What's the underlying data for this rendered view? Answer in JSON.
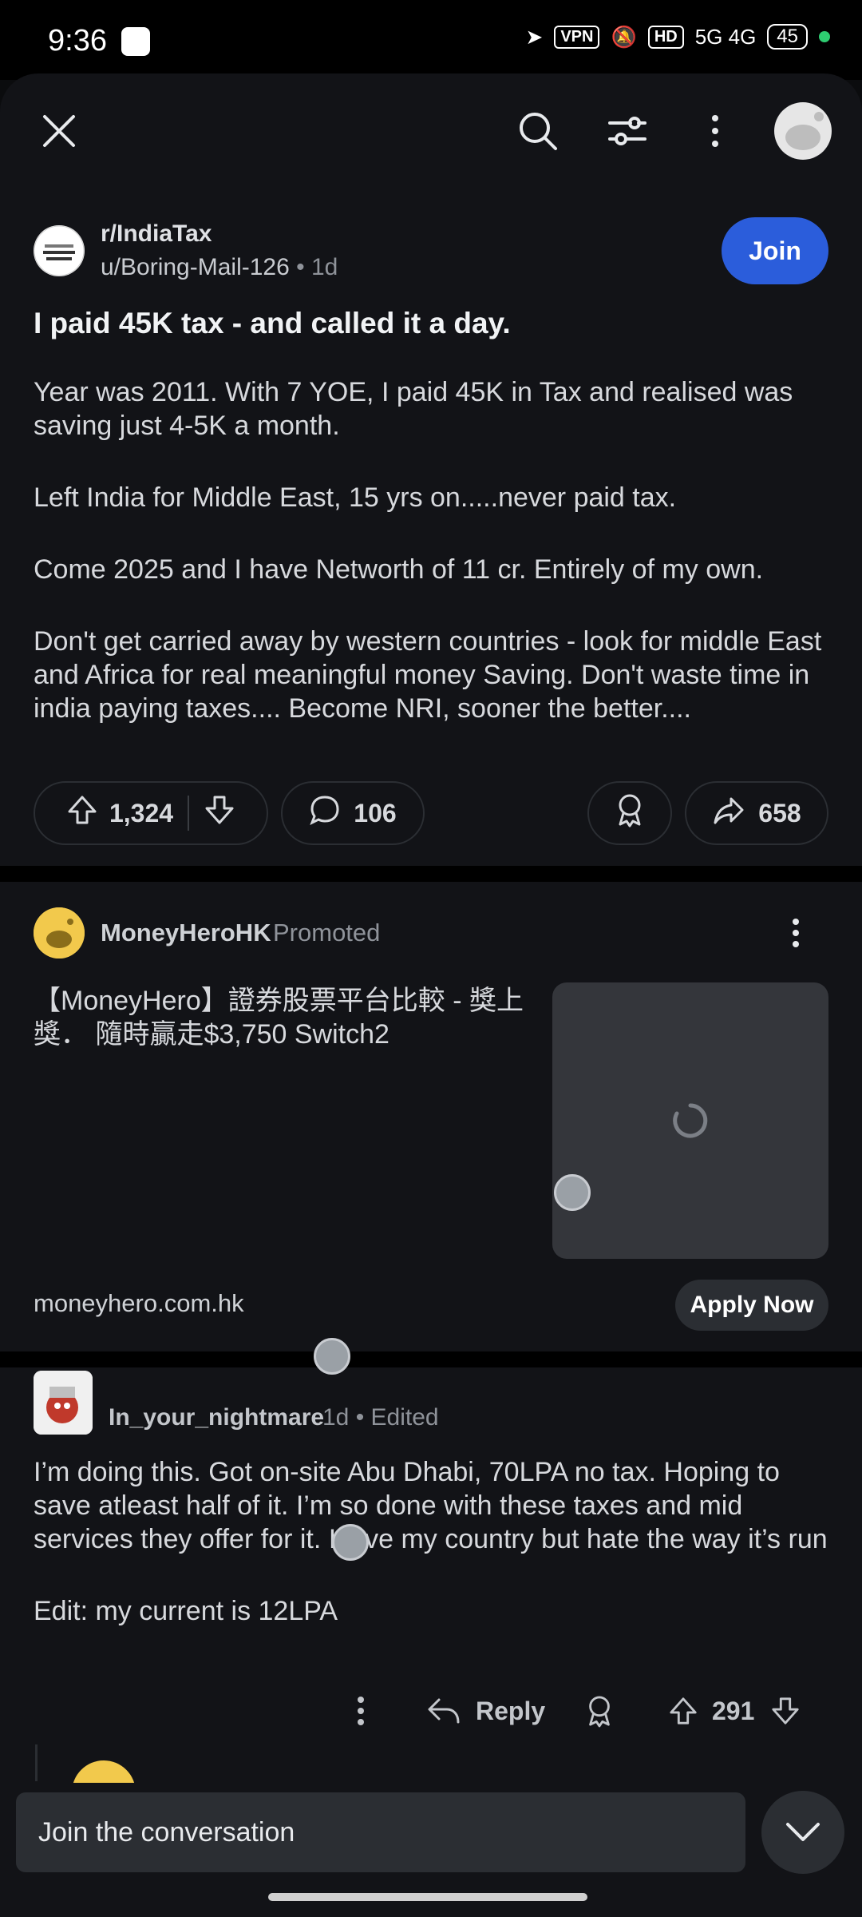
{
  "status_bar": {
    "time": "9:36",
    "vpn": "VPN",
    "hd": "HD",
    "network": "5G 4G",
    "battery": "45"
  },
  "topbar": {
    "close_icon": "close-icon",
    "search_icon": "search-icon",
    "filter_icon": "sliders-icon",
    "more_icon": "more-vertical-icon",
    "avatar": "user-avatar"
  },
  "post": {
    "subreddit": "r/IndiaTax",
    "author": "u/Boring-Mail-126",
    "age": "1d",
    "join_label": "Join",
    "title": "I paid 45K tax - and called it a day.",
    "paragraphs": [
      "Year was 2011. With 7 YOE, I paid 45K in Tax and realised was saving just 4-5K a month.",
      "Left India for Middle East, 15 yrs on.....never paid tax.",
      "Come 2025 and I have Networth of 11 cr. Entirely of my own.",
      "Don't get carried away by western countries - look for middle East and Africa for real meaningful money Saving. Don't waste time in india paying taxes.... Become NRI, sooner the better...."
    ],
    "upvotes": "1,324",
    "comments": "106",
    "shares": "658"
  },
  "ad": {
    "advertiser": "MoneyHeroHK",
    "promoted_label": "Promoted",
    "text": "【MoneyHero】證券股票平台比較 - 獎上獎． 隨時贏走$3,750 Switch2",
    "domain": "moneyhero.com.hk",
    "cta": "Apply Now"
  },
  "comment": {
    "username": "In_your_nightmare",
    "meta": "1d • Edited",
    "paragraphs": [
      "I’m doing this. Got on-site Abu Dhabi, 70LPA no tax. Hoping to save atleast half of it. I’m so done with these taxes and mid services they offer for it. I love my country but hate the way it’s run",
      "Edit: my current is 12LPA"
    ],
    "reply_label": "Reply",
    "votes": "291"
  },
  "composer": {
    "placeholder": "Join the conversation"
  },
  "colors": {
    "join_button": "#2b5ddb",
    "background": "#121317"
  }
}
